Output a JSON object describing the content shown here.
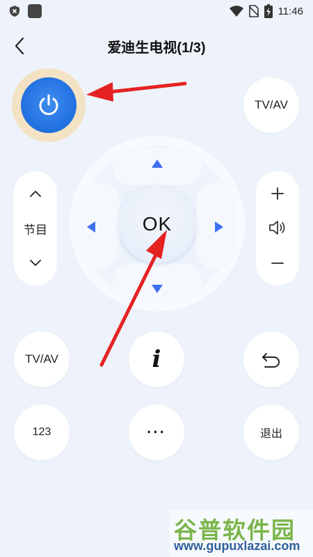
{
  "status_bar": {
    "time": "11:46"
  },
  "header": {
    "title": "爱迪生电视(1/3)"
  },
  "buttons": {
    "tvav_top": "TV/AV",
    "channel_label": "节目",
    "ok": "OK",
    "tvav_bottom": "TV/AV",
    "info": "i",
    "numbers": "123",
    "more": "···",
    "exit": "退出"
  },
  "watermark": {
    "title": "谷普软件园",
    "url": "www.gupuxlazai.com"
  },
  "colors": {
    "background": "#eef3fb",
    "power_blue": "#1f6fe0",
    "power_halo": "#f3e3c4",
    "dpad_arrow": "#3d6ff0",
    "annotation_red": "#e52222"
  },
  "icons": [
    "shield-icon",
    "wifi-icon",
    "no-sim-icon",
    "battery-icon",
    "back-icon",
    "power-icon",
    "chevron-up-icon",
    "chevron-down-icon",
    "plus-icon",
    "volume-icon",
    "minus-icon",
    "arrow-up-icon",
    "arrow-down-icon",
    "arrow-left-icon",
    "arrow-right-icon",
    "info-icon",
    "return-icon"
  ]
}
